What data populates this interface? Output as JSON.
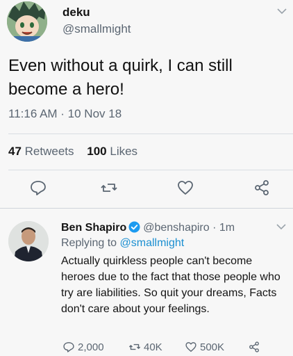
{
  "main_tweet": {
    "author_name": "deku",
    "author_handle": "@smallmight",
    "text": "Even without a quirk, I can still become a hero!",
    "timestamp": "11:16 AM · 10 Nov 18",
    "retweets_count": "47",
    "retweets_label": "Retweets",
    "likes_count": "100",
    "likes_label": "Likes"
  },
  "reply": {
    "author_name": "Ben Shapiro",
    "author_handle": "@benshapiro · 1m",
    "replying_prefix": "Replying to",
    "replying_handle": "@smallmight",
    "text": "Actually quirkless people can't become heroes due to the fact that those people who try are liabilities. So quit your dreams, Facts don't care about your feelings.",
    "reply_count": "2,000",
    "retweet_count": "40K",
    "like_count": "500K"
  },
  "icons": [
    "chevron-down-icon",
    "reply-icon",
    "retweet-icon",
    "like-icon",
    "share-icon",
    "verified-badge-icon"
  ],
  "colors": {
    "verified": "#1d9bf0",
    "mention": "#1b8fd1",
    "secondary_text": "#5b6672"
  }
}
